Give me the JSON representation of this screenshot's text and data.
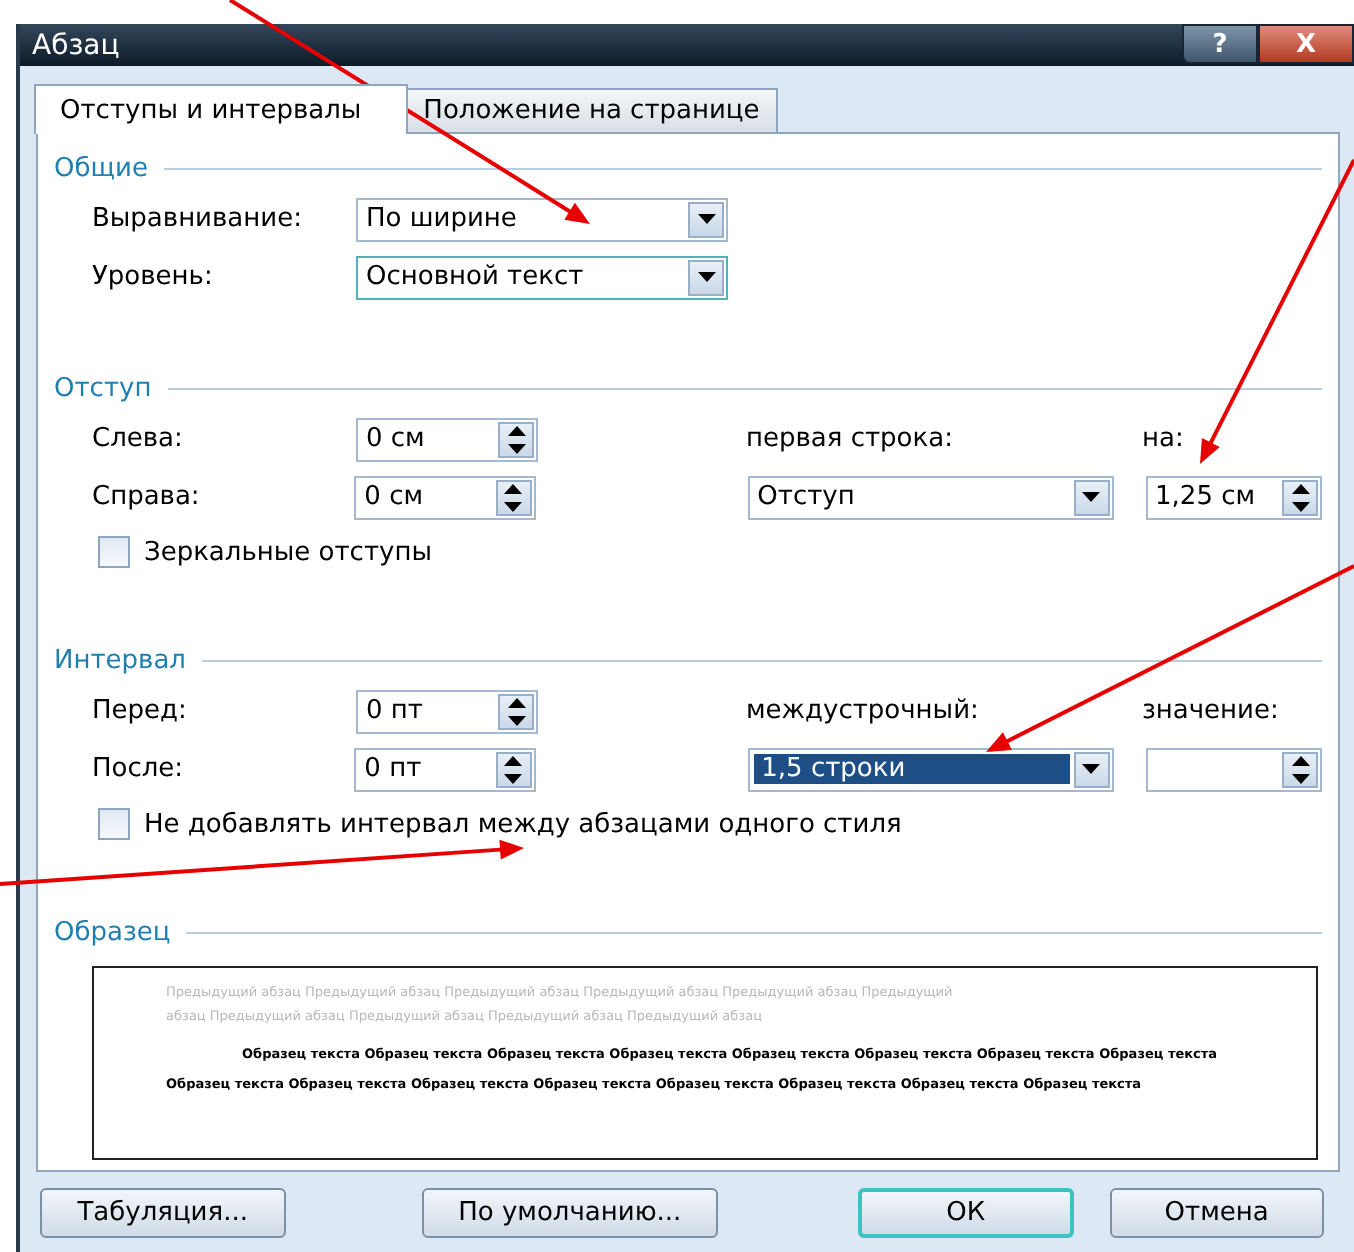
{
  "window": {
    "title": "Абзац",
    "help_button": "?",
    "close_button": "X"
  },
  "tabs": [
    {
      "label": "Отступы и интервалы",
      "selected": true
    },
    {
      "label": "Положение на странице",
      "selected": false
    }
  ],
  "general": {
    "title": "Общие",
    "alignment": {
      "label": "Выравнивание:",
      "value": "По ширине",
      "focused": false
    },
    "level": {
      "label": "Уровень:",
      "value": "Основной текст",
      "focused": true
    }
  },
  "indent": {
    "title": "Отступ",
    "left": {
      "label": "Слева:",
      "value": "0 см"
    },
    "right": {
      "label": "Справа:",
      "value": "0 см"
    },
    "first_line": {
      "label": "первая строка:",
      "value": "Отступ"
    },
    "by": {
      "label": "на:",
      "value": "1,25 см"
    },
    "mirror": {
      "label": "Зеркальные отступы",
      "checked": false
    }
  },
  "spacing": {
    "title": "Интервал",
    "before": {
      "label": "Перед:",
      "value": "0 пт"
    },
    "after": {
      "label": "После:",
      "value": "0 пт"
    },
    "line_spacing": {
      "label": "междустрочный:",
      "value": "1,5 строки",
      "selected": true
    },
    "at": {
      "label": "значение:"
    },
    "dont_add": {
      "label": "Не добавлять интервал между абзацами одного стиля",
      "checked": false
    }
  },
  "preview": {
    "title": "Образец",
    "previous_text": "Предыдущий абзац Предыдущий абзац Предыдущий абзац Предыдущий абзац Предыдущий абзац Предыдущий абзац Предыдущий абзац Предыдущий абзац Предыдущий абзац Предыдущий абзац",
    "sample_text": "Образец текста Образец текста Образец текста Образец текста Образец текста Образец текста Образец текста Образец текста Образец текста Образец текста Образец текста Образец текста Образец текста Образец текста Образец текста Образец текста"
  },
  "buttons": [
    {
      "label": "Табуляция...",
      "kind": "normal"
    },
    {
      "label": "По умолчанию...",
      "kind": "normal"
    },
    {
      "label": "ОК",
      "kind": "default"
    },
    {
      "label": "Отмена",
      "kind": "normal"
    }
  ]
}
